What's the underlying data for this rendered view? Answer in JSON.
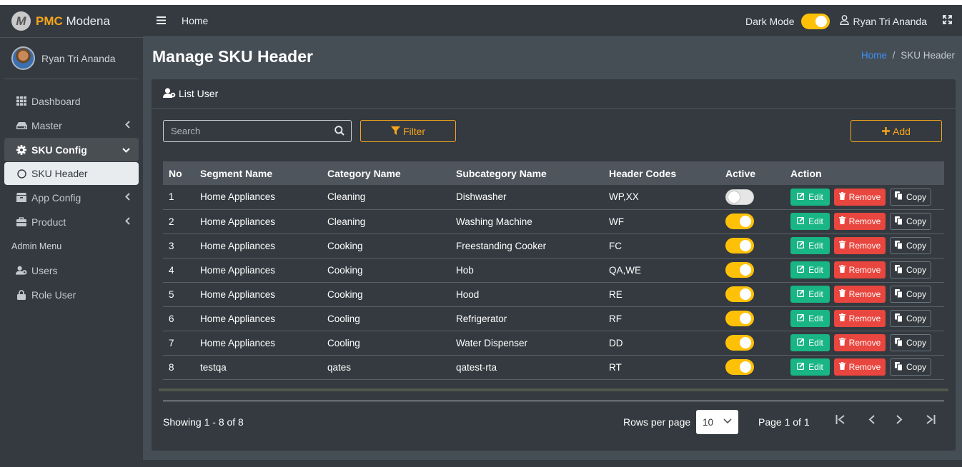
{
  "brand": {
    "strong": "PMC",
    "rest": "Modena",
    "logo_letter": "M"
  },
  "sidebar": {
    "user_name": "Ryan Tri Ananda",
    "items": [
      {
        "label": "Dashboard",
        "icon": "grid-icon"
      },
      {
        "label": "Master",
        "icon": "hdd-icon"
      },
      {
        "label": "SKU Config",
        "icon": "gear-icon"
      },
      {
        "label": "SKU Header",
        "icon": "circle-icon"
      },
      {
        "label": "App Config",
        "icon": "box-icon"
      },
      {
        "label": "Product",
        "icon": "briefcase-icon"
      }
    ],
    "header": "Admin Menu",
    "admin_items": [
      {
        "label": "Users",
        "icon": "users-icon"
      },
      {
        "label": "Role User",
        "icon": "lock-icon"
      }
    ]
  },
  "topbar": {
    "home": "Home",
    "dark_mode_label": "Dark Mode",
    "dark_mode_on": true,
    "user_name": "Ryan Tri Ananda"
  },
  "page": {
    "title": "Manage SKU Header",
    "breadcrumb_home": "Home",
    "breadcrumb_sep": "/",
    "breadcrumb_current": "SKU Header"
  },
  "card": {
    "title": "List User",
    "search_placeholder": "Search",
    "filter_label": "Filter",
    "add_label": "Add"
  },
  "table": {
    "columns": [
      "No",
      "Segment Name",
      "Category Name",
      "Subcategory Name",
      "Header Codes",
      "Active",
      "Action"
    ],
    "actions": {
      "edit": "Edit",
      "remove": "Remove",
      "copy": "Copy"
    },
    "rows": [
      {
        "no": "1",
        "segment": "Home Appliances",
        "category": "Cleaning",
        "subcategory": "Dishwasher",
        "codes": "WP,XX",
        "active": false
      },
      {
        "no": "2",
        "segment": "Home Appliances",
        "category": "Cleaning",
        "subcategory": "Washing Machine",
        "codes": "WF",
        "active": true
      },
      {
        "no": "3",
        "segment": "Home Appliances",
        "category": "Cooking",
        "subcategory": "Freestanding Cooker",
        "codes": "FC",
        "active": true
      },
      {
        "no": "4",
        "segment": "Home Appliances",
        "category": "Cooking",
        "subcategory": "Hob",
        "codes": "QA,WE",
        "active": true
      },
      {
        "no": "5",
        "segment": "Home Appliances",
        "category": "Cooking",
        "subcategory": "Hood",
        "codes": "RE",
        "active": true
      },
      {
        "no": "6",
        "segment": "Home Appliances",
        "category": "Cooling",
        "subcategory": "Refrigerator",
        "codes": "RF",
        "active": true
      },
      {
        "no": "7",
        "segment": "Home Appliances",
        "category": "Cooling",
        "subcategory": "Water Dispenser",
        "codes": "DD",
        "active": true
      },
      {
        "no": "8",
        "segment": "testqa",
        "category": "qates",
        "subcategory": "qatest-rta",
        "codes": "RT",
        "active": true
      }
    ]
  },
  "pagination": {
    "showing": "Showing 1 - 8 of 8",
    "rows_per_page_label": "Rows per page",
    "rows_per_page_value": "10",
    "page_info": "Page 1 of 1"
  },
  "colors": {
    "accent": "#f7a51c",
    "toggle_on": "#ffc107",
    "edit": "#19b584",
    "remove": "#e8463e",
    "link": "#3f8ff5"
  }
}
